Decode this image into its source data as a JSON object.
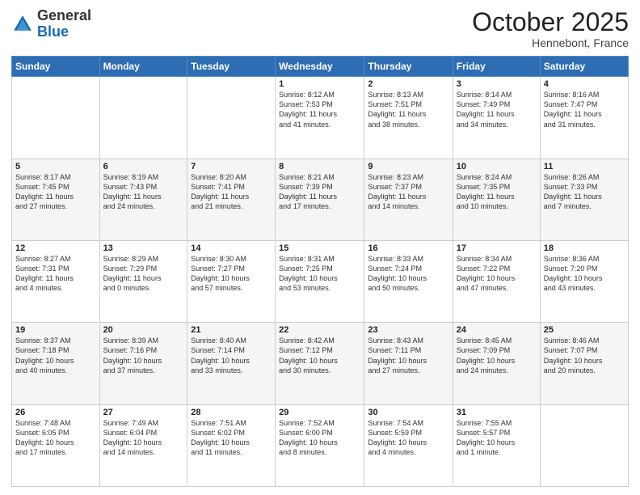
{
  "header": {
    "logo_general": "General",
    "logo_blue": "Blue",
    "month": "October 2025",
    "location": "Hennebont, France"
  },
  "weekdays": [
    "Sunday",
    "Monday",
    "Tuesday",
    "Wednesday",
    "Thursday",
    "Friday",
    "Saturday"
  ],
  "weeks": [
    [
      {
        "day": "",
        "info": ""
      },
      {
        "day": "",
        "info": ""
      },
      {
        "day": "",
        "info": ""
      },
      {
        "day": "1",
        "info": "Sunrise: 8:12 AM\nSunset: 7:53 PM\nDaylight: 11 hours\nand 41 minutes."
      },
      {
        "day": "2",
        "info": "Sunrise: 8:13 AM\nSunset: 7:51 PM\nDaylight: 11 hours\nand 38 minutes."
      },
      {
        "day": "3",
        "info": "Sunrise: 8:14 AM\nSunset: 7:49 PM\nDaylight: 11 hours\nand 34 minutes."
      },
      {
        "day": "4",
        "info": "Sunrise: 8:16 AM\nSunset: 7:47 PM\nDaylight: 11 hours\nand 31 minutes."
      }
    ],
    [
      {
        "day": "5",
        "info": "Sunrise: 8:17 AM\nSunset: 7:45 PM\nDaylight: 11 hours\nand 27 minutes."
      },
      {
        "day": "6",
        "info": "Sunrise: 8:19 AM\nSunset: 7:43 PM\nDaylight: 11 hours\nand 24 minutes."
      },
      {
        "day": "7",
        "info": "Sunrise: 8:20 AM\nSunset: 7:41 PM\nDaylight: 11 hours\nand 21 minutes."
      },
      {
        "day": "8",
        "info": "Sunrise: 8:21 AM\nSunset: 7:39 PM\nDaylight: 11 hours\nand 17 minutes."
      },
      {
        "day": "9",
        "info": "Sunrise: 8:23 AM\nSunset: 7:37 PM\nDaylight: 11 hours\nand 14 minutes."
      },
      {
        "day": "10",
        "info": "Sunrise: 8:24 AM\nSunset: 7:35 PM\nDaylight: 11 hours\nand 10 minutes."
      },
      {
        "day": "11",
        "info": "Sunrise: 8:26 AM\nSunset: 7:33 PM\nDaylight: 11 hours\nand 7 minutes."
      }
    ],
    [
      {
        "day": "12",
        "info": "Sunrise: 8:27 AM\nSunset: 7:31 PM\nDaylight: 11 hours\nand 4 minutes."
      },
      {
        "day": "13",
        "info": "Sunrise: 8:29 AM\nSunset: 7:29 PM\nDaylight: 11 hours\nand 0 minutes."
      },
      {
        "day": "14",
        "info": "Sunrise: 8:30 AM\nSunset: 7:27 PM\nDaylight: 10 hours\nand 57 minutes."
      },
      {
        "day": "15",
        "info": "Sunrise: 8:31 AM\nSunset: 7:25 PM\nDaylight: 10 hours\nand 53 minutes."
      },
      {
        "day": "16",
        "info": "Sunrise: 8:33 AM\nSunset: 7:24 PM\nDaylight: 10 hours\nand 50 minutes."
      },
      {
        "day": "17",
        "info": "Sunrise: 8:34 AM\nSunset: 7:22 PM\nDaylight: 10 hours\nand 47 minutes."
      },
      {
        "day": "18",
        "info": "Sunrise: 8:36 AM\nSunset: 7:20 PM\nDaylight: 10 hours\nand 43 minutes."
      }
    ],
    [
      {
        "day": "19",
        "info": "Sunrise: 8:37 AM\nSunset: 7:18 PM\nDaylight: 10 hours\nand 40 minutes."
      },
      {
        "day": "20",
        "info": "Sunrise: 8:39 AM\nSunset: 7:16 PM\nDaylight: 10 hours\nand 37 minutes."
      },
      {
        "day": "21",
        "info": "Sunrise: 8:40 AM\nSunset: 7:14 PM\nDaylight: 10 hours\nand 33 minutes."
      },
      {
        "day": "22",
        "info": "Sunrise: 8:42 AM\nSunset: 7:12 PM\nDaylight: 10 hours\nand 30 minutes."
      },
      {
        "day": "23",
        "info": "Sunrise: 8:43 AM\nSunset: 7:11 PM\nDaylight: 10 hours\nand 27 minutes."
      },
      {
        "day": "24",
        "info": "Sunrise: 8:45 AM\nSunset: 7:09 PM\nDaylight: 10 hours\nand 24 minutes."
      },
      {
        "day": "25",
        "info": "Sunrise: 8:46 AM\nSunset: 7:07 PM\nDaylight: 10 hours\nand 20 minutes."
      }
    ],
    [
      {
        "day": "26",
        "info": "Sunrise: 7:48 AM\nSunset: 6:05 PM\nDaylight: 10 hours\nand 17 minutes."
      },
      {
        "day": "27",
        "info": "Sunrise: 7:49 AM\nSunset: 6:04 PM\nDaylight: 10 hours\nand 14 minutes."
      },
      {
        "day": "28",
        "info": "Sunrise: 7:51 AM\nSunset: 6:02 PM\nDaylight: 10 hours\nand 11 minutes."
      },
      {
        "day": "29",
        "info": "Sunrise: 7:52 AM\nSunset: 6:00 PM\nDaylight: 10 hours\nand 8 minutes."
      },
      {
        "day": "30",
        "info": "Sunrise: 7:54 AM\nSunset: 5:59 PM\nDaylight: 10 hours\nand 4 minutes."
      },
      {
        "day": "31",
        "info": "Sunrise: 7:55 AM\nSunset: 5:57 PM\nDaylight: 10 hours\nand 1 minute."
      },
      {
        "day": "",
        "info": ""
      }
    ]
  ]
}
